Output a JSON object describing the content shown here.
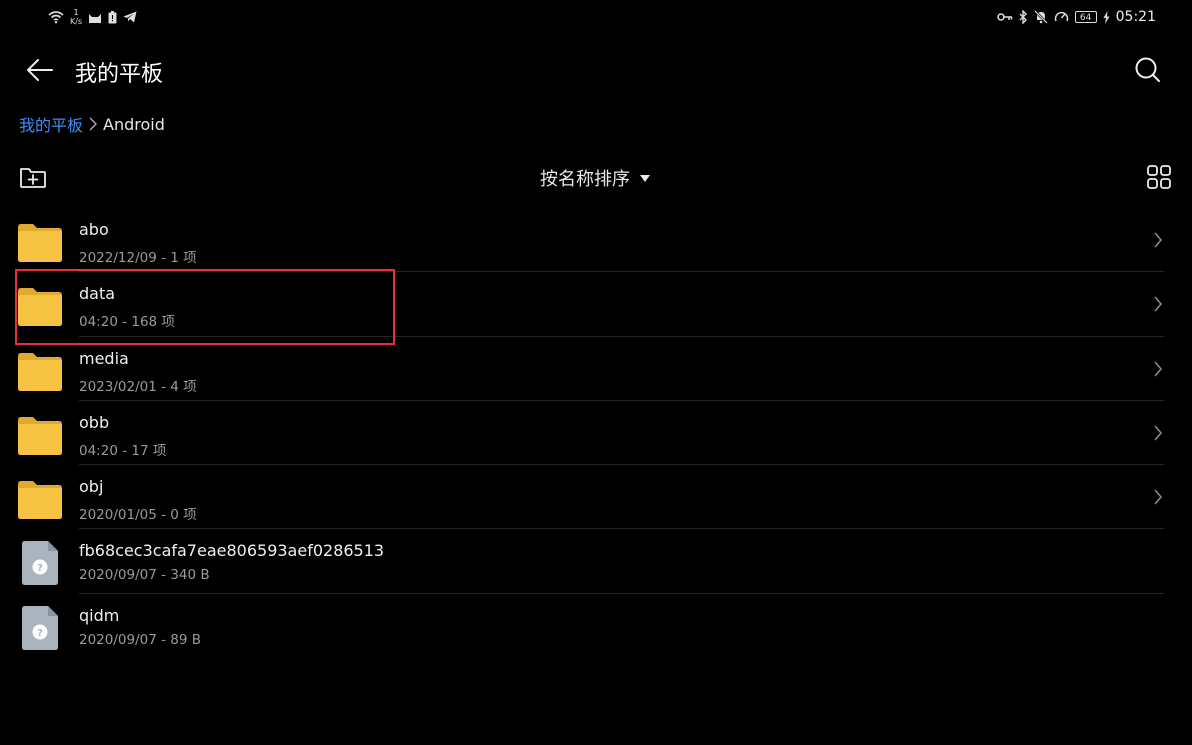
{
  "status_bar": {
    "net_speed_value": "1",
    "net_speed_unit": "K/s",
    "battery": "64",
    "time": "05:21"
  },
  "header": {
    "title": "我的平板"
  },
  "breadcrumb": {
    "root": "我的平板",
    "current": "Android"
  },
  "toolbar": {
    "sort_label": "按名称排序"
  },
  "files": [
    {
      "name": "abo",
      "meta": "2022/12/09 - 1 项",
      "type": "folder"
    },
    {
      "name": "data",
      "meta": "04:20 - 168 项",
      "type": "folder"
    },
    {
      "name": "media",
      "meta": "2023/02/01 - 4 项",
      "type": "folder"
    },
    {
      "name": "obb",
      "meta": "04:20 - 17 项",
      "type": "folder"
    },
    {
      "name": "obj",
      "meta": "2020/01/05 - 0 项",
      "type": "folder"
    },
    {
      "name": "fb68cec3cafa7eae806593aef0286513",
      "meta": "2020/09/07 - 340 B",
      "type": "file"
    },
    {
      "name": "qidm",
      "meta": "2020/09/07 - 89 B",
      "type": "file"
    }
  ],
  "colors": {
    "accent": "#3b8ef2",
    "folder": "#f5c242",
    "highlight": "#e8303a"
  }
}
